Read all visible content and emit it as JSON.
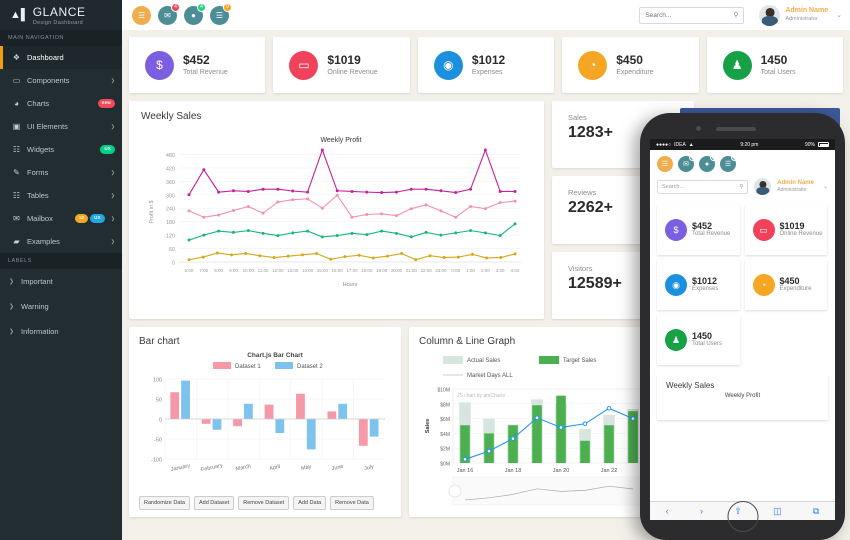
{
  "sidebar": {
    "brand": {
      "name": "GLANCE",
      "subtitle": "Design Dashboard",
      "icon": "chart-logo-icon"
    },
    "nav_header": "MAIN NAVIGATION",
    "items": [
      {
        "label": "Dashboard",
        "icon": "dashboard-icon",
        "active": true,
        "arrow": "",
        "badges": []
      },
      {
        "label": "Components",
        "icon": "monitor-icon",
        "active": false,
        "arrow": "❯",
        "badges": []
      },
      {
        "label": "Charts",
        "icon": "pie-chart-icon",
        "active": false,
        "arrow": "",
        "badges": [
          {
            "text": "new",
            "color": "red"
          }
        ]
      },
      {
        "label": "UI Elements",
        "icon": "window-icon",
        "active": false,
        "arrow": "❯",
        "badges": []
      },
      {
        "label": "Widgets",
        "icon": "grid-icon",
        "active": false,
        "arrow": "",
        "badges": [
          {
            "text": "UX",
            "color": "green"
          }
        ]
      },
      {
        "label": "Forms",
        "icon": "edit-icon",
        "active": false,
        "arrow": "❯",
        "badges": []
      },
      {
        "label": "Tables",
        "icon": "table-icon",
        "active": false,
        "arrow": "❯",
        "badges": []
      },
      {
        "label": "Mailbox",
        "icon": "envelope-icon",
        "active": false,
        "arrow": "❯",
        "badges": [
          {
            "text": "12",
            "color": "orange"
          },
          {
            "text": "UX",
            "color": "blue"
          }
        ]
      },
      {
        "label": "Examples",
        "icon": "folder-icon",
        "active": false,
        "arrow": "❯",
        "badges": []
      }
    ],
    "labels_header": "LABELS",
    "labels": [
      {
        "label": "Important",
        "chevron": "❯"
      },
      {
        "label": "Warning",
        "chevron": "❯"
      },
      {
        "label": "Information",
        "chevron": "❯"
      }
    ]
  },
  "header": {
    "menu_icon": "hamburger-icon",
    "notifications": [
      {
        "icon": "envelope-icon",
        "glyph": "✉",
        "count": "4",
        "color": "red"
      },
      {
        "icon": "bell-icon",
        "glyph": "●",
        "count": "4",
        "color": "green"
      },
      {
        "icon": "flag-icon",
        "glyph": "☰",
        "count": "9",
        "color": "orange"
      }
    ],
    "search": {
      "placeholder": "Search...",
      "value": "",
      "icon": "search-icon"
    },
    "user": {
      "name": "Admin Name",
      "role": "Administrator",
      "caret": "⌄"
    }
  },
  "stats": [
    {
      "value": "$452",
      "label": "Total Revenue",
      "glyph": "$",
      "icon": "dollar-icon",
      "color": "#7b5fe0"
    },
    {
      "value": "$1019",
      "label": "Online Revenue",
      "glyph": "▭",
      "icon": "laptop-icon",
      "color": "#f2415a"
    },
    {
      "value": "$1012",
      "label": "Expenses",
      "glyph": "◉",
      "icon": "money-icon",
      "color": "#1c8fdd"
    },
    {
      "value": "$450",
      "label": "Expenditure",
      "glyph": "◔",
      "icon": "pie-chart-icon",
      "color": "#f5a623"
    },
    {
      "value": "1450",
      "label": "Total Users",
      "glyph": "♟",
      "icon": "users-icon",
      "color": "#16a147"
    }
  ],
  "side_stats": [
    {
      "label": "Sales",
      "value": "1283+"
    },
    {
      "label": "Reviews",
      "value": "2262+"
    },
    {
      "label": "Visitors",
      "value": "12589+"
    }
  ],
  "chart_data": [
    {
      "type": "line",
      "title": "Weekly Sales",
      "annotation": "Weekly Profit",
      "xlabel": "Hours",
      "ylabel": "Profit in $",
      "ylim": [
        0,
        500
      ],
      "yticks": [
        0,
        60,
        120,
        180,
        240,
        300,
        360,
        420,
        480
      ],
      "x": [
        "6:00",
        "7:00",
        "8:00",
        "9:00",
        "10:00",
        "11:00",
        "12:00",
        "13:00",
        "14:00",
        "15:00",
        "16:00",
        "17:00",
        "18:00",
        "19:00",
        "20:00",
        "21:00",
        "22:00",
        "23:00",
        "0:00",
        "1:00",
        "2:00",
        "3:00",
        "4:00"
      ],
      "grid": true,
      "legend": "none",
      "series": [
        {
          "name": "Magenta Profit",
          "color": "#c6229b",
          "values": [
            300,
            412,
            312,
            318,
            315,
            325,
            325,
            317,
            312,
            500,
            318,
            315,
            312,
            310,
            312,
            325,
            325,
            318,
            310,
            325,
            500,
            315,
            315
          ]
        },
        {
          "name": "Pink Sales",
          "color": "#f48fb1",
          "values": [
            228,
            200,
            210,
            230,
            248,
            218,
            268,
            278,
            282,
            240,
            298,
            200,
            212,
            215,
            207,
            238,
            255,
            228,
            200,
            248,
            238,
            265,
            272
          ]
        },
        {
          "name": "Green Orders",
          "color": "#14b87a",
          "values": [
            98,
            120,
            138,
            132,
            140,
            128,
            118,
            130,
            138,
            112,
            118,
            128,
            122,
            138,
            128,
            112,
            132,
            120,
            130,
            140,
            130,
            118,
            170
          ]
        },
        {
          "name": "Yellow Visits",
          "color": "#d4a818",
          "values": [
            10,
            22,
            40,
            32,
            38,
            28,
            20,
            26,
            32,
            38,
            12,
            24,
            30,
            18,
            26,
            38,
            10,
            28,
            20,
            22,
            34,
            18,
            20,
            36
          ]
        }
      ]
    },
    {
      "type": "bar",
      "title": "Bar chart",
      "subtitle": "Chart.js Bar Chart",
      "categories": [
        "January",
        "February",
        "March",
        "April",
        "May",
        "June",
        "July"
      ],
      "ylim": [
        -100,
        100
      ],
      "yticks": [
        -100,
        -50,
        0,
        50,
        100
      ],
      "grid": true,
      "legend": "top",
      "series": [
        {
          "name": "Dataset 1",
          "color": "#f598a8",
          "values": [
            67,
            -12,
            -18,
            36,
            63,
            19,
            -67
          ]
        },
        {
          "name": "Dataset 2",
          "color": "#7ec2ee",
          "values": [
            96,
            -27,
            38,
            -35,
            -76,
            38,
            -44
          ]
        }
      ],
      "buttons": [
        "Randomize Data",
        "Add Dataset",
        "Remove Dataset",
        "Add Data",
        "Remove Data"
      ]
    },
    {
      "type": "bar",
      "title": "Column & Line Graph",
      "watermark": "JS chart by amCharts",
      "ylabel": "Sales",
      "ylim": [
        0,
        10
      ],
      "yticks": [
        "$0M",
        "$2M",
        "$4M",
        "$6M",
        "$8M",
        "$10M"
      ],
      "categories": [
        "Jan 16",
        "",
        "Jan 18",
        "",
        "Jan 20",
        "",
        "Jan 22",
        ""
      ],
      "xticks": [
        "Jan 16",
        "Jan 18",
        "Jan 20",
        "Jan 22"
      ],
      "grid": true,
      "legend": "top",
      "series": [
        {
          "name": "Actual Sales",
          "color": "#d6e6de",
          "values": [
            8.2,
            6.0,
            5.2,
            8.6,
            8.0,
            4.6,
            6.5,
            7.3
          ]
        },
        {
          "name": "Target Sales",
          "color": "#4caf50",
          "values": [
            5.1,
            4.0,
            5.1,
            7.8,
            9.1,
            3.0,
            5.1,
            7.0
          ]
        },
        {
          "name": "Market Days ALL",
          "color": "#2196f3",
          "values": [
            0.5,
            1.6,
            3.3,
            6.1,
            4.8,
            5.3,
            7.4,
            6.0
          ],
          "kind": "line"
        }
      ]
    }
  ],
  "phone": {
    "status": {
      "signal": "●●●●○",
      "carrier": "IDEA",
      "wifi": "▲",
      "time": "9:20 pm",
      "battery": "90%"
    },
    "menu_icon": "hamburger-icon",
    "notifications": [
      {
        "icon": "envelope-icon",
        "glyph": "✉",
        "count": "4",
        "color": "red"
      },
      {
        "icon": "bell-icon",
        "glyph": "●",
        "count": "4",
        "color": "green"
      },
      {
        "icon": "flag-icon",
        "glyph": "☰",
        "count": "9",
        "color": "orange"
      }
    ],
    "search": {
      "placeholder": "Search...",
      "icon": "search-icon"
    },
    "user": {
      "name": "Admin Name",
      "role": "Administrator",
      "caret": "⌄"
    },
    "weekly_title": "Weekly Sales",
    "weekly_annotation": "Weekly Profit",
    "toolbar": [
      {
        "icon": "back-icon",
        "glyph": "‹"
      },
      {
        "icon": "forward-icon",
        "glyph": "›"
      },
      {
        "icon": "share-icon",
        "glyph": "⇧"
      },
      {
        "icon": "bookmarks-icon",
        "glyph": "◫"
      },
      {
        "icon": "tabs-icon",
        "glyph": "⧉"
      }
    ]
  }
}
